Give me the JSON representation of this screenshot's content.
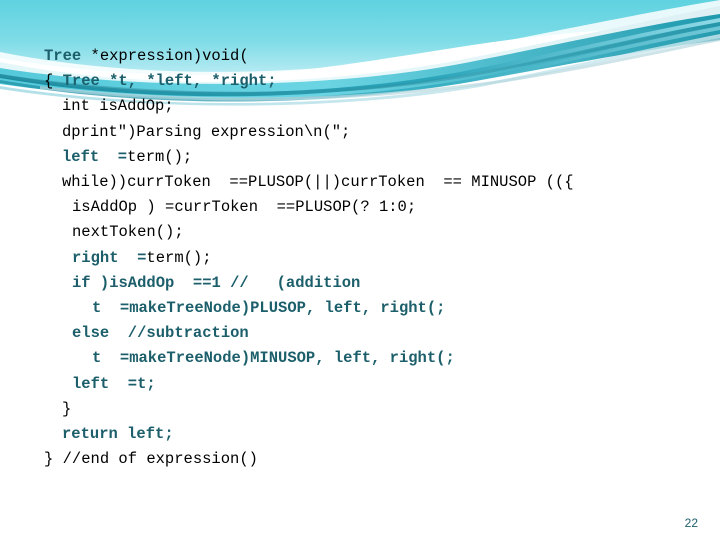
{
  "slide": {
    "number": "22",
    "theme": {
      "accent_teal": "#1c5f6b",
      "banner_cyan": "#66d5e2",
      "banner_deep": "#22a3b5",
      "banner_pale": "#bfeaf2",
      "background": "#ffffff"
    }
  },
  "code": {
    "language": "c",
    "lines": [
      {
        "indent": 44,
        "segments": [
          {
            "text": "Tree ",
            "style": "bold"
          },
          {
            "text": "*expression)void(",
            "style": "normal"
          }
        ]
      },
      {
        "indent": 44,
        "segments": [
          {
            "text": "{ ",
            "style": "normal"
          },
          {
            "text": "Tree *t, *left, *right;",
            "style": "bold"
          }
        ]
      },
      {
        "indent": 62,
        "segments": [
          {
            "text": "int isAddOp;",
            "style": "normal"
          }
        ]
      },
      {
        "indent": 62,
        "segments": [
          {
            "text": "dprint\")Parsing expression\\n(\";",
            "style": "normal"
          }
        ]
      },
      {
        "indent": 62,
        "segments": [
          {
            "text": "left  =",
            "style": "bold"
          },
          {
            "text": "term();",
            "style": "normal"
          }
        ]
      },
      {
        "indent": 62,
        "segments": [
          {
            "text": "while))currToken  ==PLUSOP(||)currToken  == MINUSOP (({",
            "style": "normal"
          }
        ]
      },
      {
        "indent": 72,
        "segments": [
          {
            "text": "isAddOp ) =currToken  ==PLUSOP(? 1:0;",
            "style": "normal"
          }
        ]
      },
      {
        "indent": 72,
        "segments": [
          {
            "text": "nextToken();",
            "style": "normal"
          }
        ]
      },
      {
        "indent": 72,
        "segments": [
          {
            "text": "right  =",
            "style": "bold"
          },
          {
            "text": "term();",
            "style": "normal"
          }
        ]
      },
      {
        "indent": 72,
        "segments": [
          {
            "text": "if )isAddOp  ==1 //   (addition",
            "style": "bold"
          }
        ]
      },
      {
        "indent": 92,
        "segments": [
          {
            "text": "t  =makeTreeNode)PLUSOP, left, right(;",
            "style": "bold"
          }
        ]
      },
      {
        "indent": 72,
        "segments": [
          {
            "text": "else  //subtraction",
            "style": "bold"
          }
        ]
      },
      {
        "indent": 92,
        "segments": [
          {
            "text": "t  =makeTreeNode)MINUSOP, left, right(;",
            "style": "bold"
          }
        ]
      },
      {
        "indent": 72,
        "segments": [
          {
            "text": "left  =t;",
            "style": "bold"
          }
        ]
      },
      {
        "indent": 62,
        "segments": [
          {
            "text": "}",
            "style": "normal"
          }
        ]
      },
      {
        "indent": 62,
        "segments": [
          {
            "text": "return left;",
            "style": "bold"
          }
        ]
      },
      {
        "indent": 44,
        "segments": [
          {
            "text": "} ",
            "style": "normal"
          },
          {
            "text": "//end of expression()",
            "style": "normal"
          }
        ]
      }
    ]
  }
}
